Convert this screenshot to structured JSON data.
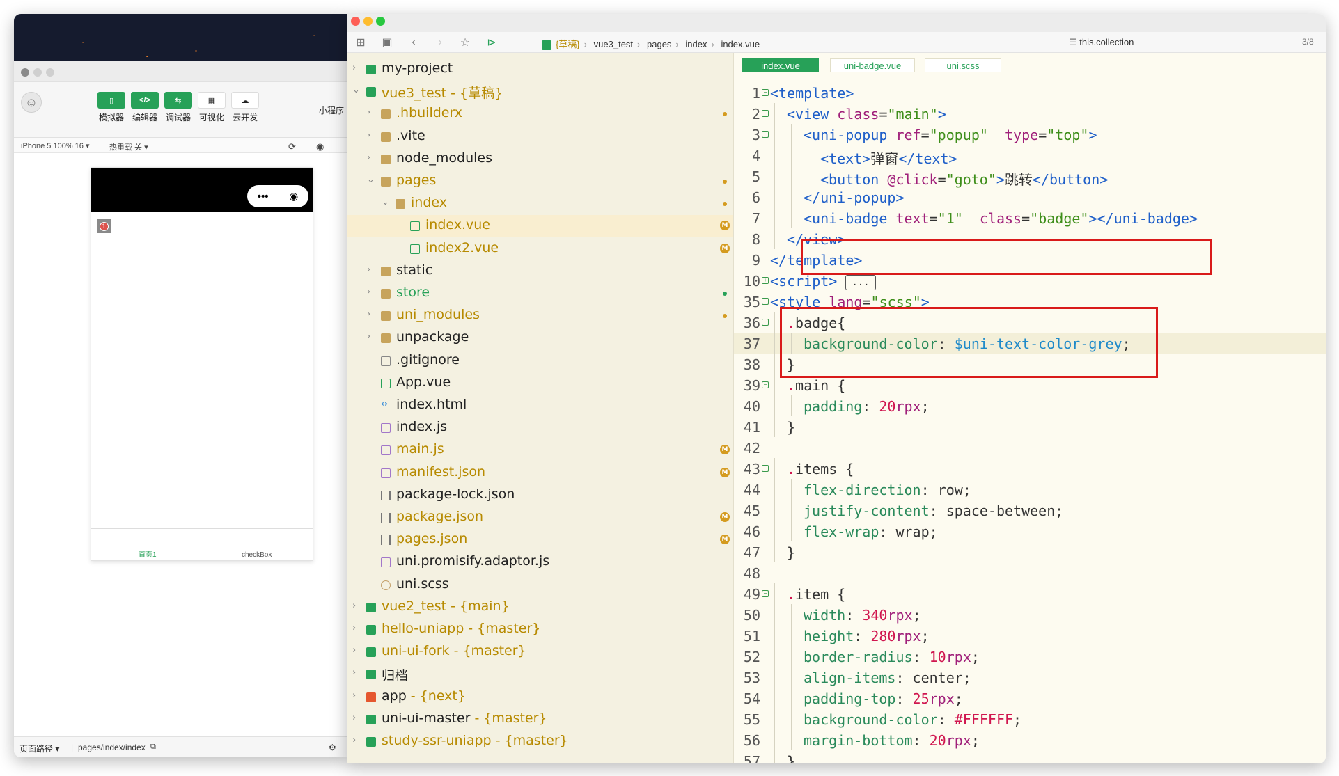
{
  "simulator": {
    "toolbar": [
      {
        "label": "模拟器",
        "icon": "phone-icon",
        "style": "green"
      },
      {
        "label": "编辑器",
        "icon": "code-icon",
        "style": "green"
      },
      {
        "label": "调试器",
        "icon": "debug-icon",
        "style": "green"
      },
      {
        "label": "可视化",
        "icon": "layout-icon",
        "style": "white"
      },
      {
        "label": "云开发",
        "icon": "cloud-icon",
        "style": "white"
      }
    ],
    "mini_program_label": "小程序",
    "device": "iPhone 5 100% 16 ▾",
    "hot_reload": "热重载 关 ▾",
    "capsule_more": "•••",
    "badge_text": "1",
    "tabbar": [
      {
        "label": "首页1",
        "color": "#27a158"
      },
      {
        "label": "checkBox",
        "color": "#555555"
      }
    ],
    "footer_path_label": "页面路径 ▾",
    "footer_path": "pages/index/index"
  },
  "editor": {
    "breadcrumb": [
      "{草稿}",
      "vue3_test",
      "pages",
      "index",
      "index.vue"
    ],
    "search_text": "this.collection",
    "search_count": "3/8",
    "tree": [
      {
        "name": "my-project",
        "sub": "",
        "icon": "project",
        "level": 0,
        "arrow": "›",
        "mark": ""
      },
      {
        "name": "vue3_test",
        "sub": " - {草稿}",
        "icon": "project",
        "level": 0,
        "arrow": "⌄",
        "mark": "",
        "color": "#b78a00"
      },
      {
        "name": ".hbuilderx",
        "sub": "",
        "icon": "folder",
        "level": 1,
        "arrow": "›",
        "mark": "dot",
        "color": "#b78a00"
      },
      {
        "name": ".vite",
        "sub": "",
        "icon": "folder",
        "level": 1,
        "arrow": "›",
        "mark": ""
      },
      {
        "name": "node_modules",
        "sub": "",
        "icon": "folder",
        "level": 1,
        "arrow": "›",
        "mark": ""
      },
      {
        "name": "pages",
        "sub": "",
        "icon": "folder",
        "level": 1,
        "arrow": "⌄",
        "mark": "dot",
        "color": "#b78a00"
      },
      {
        "name": "index",
        "sub": "",
        "icon": "folder",
        "level": 2,
        "arrow": "⌄",
        "mark": "dot",
        "color": "#b78a00"
      },
      {
        "name": "index.vue",
        "sub": "",
        "icon": "vue",
        "level": 3,
        "arrow": "",
        "mark": "M",
        "color": "#b78a00",
        "selected": true
      },
      {
        "name": "index2.vue",
        "sub": "",
        "icon": "vue",
        "level": 3,
        "arrow": "",
        "mark": "M",
        "color": "#b78a00"
      },
      {
        "name": "static",
        "sub": "",
        "icon": "folder",
        "level": 1,
        "arrow": "›",
        "mark": ""
      },
      {
        "name": "store",
        "sub": "",
        "icon": "folder",
        "level": 1,
        "arrow": "›",
        "mark": "dotg",
        "color": "#27a158"
      },
      {
        "name": "uni_modules",
        "sub": "",
        "icon": "folder",
        "level": 1,
        "arrow": "›",
        "mark": "dot",
        "color": "#b78a00"
      },
      {
        "name": "unpackage",
        "sub": "",
        "icon": "folder",
        "level": 1,
        "arrow": "›",
        "mark": ""
      },
      {
        "name": ".gitignore",
        "sub": "",
        "icon": "file",
        "level": 1,
        "arrow": "",
        "mark": ""
      },
      {
        "name": "App.vue",
        "sub": "",
        "icon": "vue",
        "level": 1,
        "arrow": "",
        "mark": ""
      },
      {
        "name": "index.html",
        "sub": "",
        "icon": "html",
        "level": 1,
        "arrow": "",
        "mark": ""
      },
      {
        "name": "index.js",
        "sub": "",
        "icon": "js",
        "level": 1,
        "arrow": "",
        "mark": ""
      },
      {
        "name": "main.js",
        "sub": "",
        "icon": "js",
        "level": 1,
        "arrow": "",
        "mark": "M",
        "color": "#b78a00"
      },
      {
        "name": "manifest.json",
        "sub": "",
        "icon": "js",
        "level": 1,
        "arrow": "",
        "mark": "M",
        "color": "#b78a00"
      },
      {
        "name": "package-lock.json",
        "sub": "",
        "icon": "json",
        "level": 1,
        "arrow": "",
        "mark": ""
      },
      {
        "name": "package.json",
        "sub": "",
        "icon": "json",
        "level": 1,
        "arrow": "",
        "mark": "M",
        "color": "#b78a00"
      },
      {
        "name": "pages.json",
        "sub": "",
        "icon": "json",
        "level": 1,
        "arrow": "",
        "mark": "M",
        "color": "#b78a00"
      },
      {
        "name": "uni.promisify.adaptor.js",
        "sub": "",
        "icon": "js",
        "level": 1,
        "arrow": "",
        "mark": ""
      },
      {
        "name": "uni.scss",
        "sub": "",
        "icon": "scss",
        "level": 1,
        "arrow": "",
        "mark": ""
      },
      {
        "name": "vue2_test",
        "sub": " - {main}",
        "icon": "project",
        "level": 0,
        "arrow": "›",
        "mark": "",
        "color": "#b78a00"
      },
      {
        "name": "hello-uniapp",
        "sub": " - {master}",
        "icon": "project",
        "level": 0,
        "arrow": "›",
        "mark": "",
        "color": "#b78a00"
      },
      {
        "name": "uni-ui-fork",
        "sub": " - {master}",
        "icon": "project",
        "level": 0,
        "arrow": "›",
        "mark": "",
        "color": "#b78a00"
      },
      {
        "name": "归档",
        "sub": "",
        "icon": "project",
        "level": 0,
        "arrow": "›",
        "mark": ""
      },
      {
        "name": "app",
        "sub": " - {next}",
        "icon": "app",
        "level": 0,
        "arrow": "›",
        "mark": ""
      },
      {
        "name": "uni-ui-master",
        "sub": " - {master}",
        "icon": "project",
        "level": 0,
        "arrow": "›",
        "mark": ""
      },
      {
        "name": "study-ssr-uniapp",
        "sub": " - {master}",
        "icon": "project",
        "level": 0,
        "arrow": "›",
        "mark": "",
        "color": "#b78a00"
      }
    ],
    "tabs": [
      {
        "label": "index.vue",
        "active": true
      },
      {
        "label": "uni-badge.vue",
        "active": false
      },
      {
        "label": "uni.scss",
        "active": false
      }
    ],
    "code": [
      {
        "no": "1",
        "fold": "⊟",
        "indent": 0,
        "tokens": [
          [
            "t",
            "<template>"
          ]
        ]
      },
      {
        "no": "2",
        "fold": "⊟",
        "indent": 1,
        "tokens": [
          [
            "t",
            "<view "
          ],
          [
            "a",
            "class"
          ],
          [
            "",
            "="
          ],
          [
            "s",
            "\"main\""
          ],
          [
            "t",
            ">"
          ]
        ]
      },
      {
        "no": "3",
        "fold": "⊟",
        "indent": 2,
        "tokens": [
          [
            "t",
            "<uni-popup "
          ],
          [
            "a",
            "ref"
          ],
          [
            "",
            "="
          ],
          [
            "s",
            "\"popup\""
          ],
          [
            "",
            "  "
          ],
          [
            "a",
            "type"
          ],
          [
            "",
            "="
          ],
          [
            "s",
            "\"top\""
          ],
          [
            "t",
            ">"
          ]
        ]
      },
      {
        "no": "4",
        "fold": "",
        "indent": 3,
        "tokens": [
          [
            "t",
            "<text>"
          ],
          [
            "",
            "弹窗"
          ],
          [
            "t",
            "</text>"
          ]
        ]
      },
      {
        "no": "5",
        "fold": "",
        "indent": 3,
        "tokens": [
          [
            "t",
            "<button "
          ],
          [
            "a",
            "@click"
          ],
          [
            "",
            "="
          ],
          [
            "s",
            "\"goto\""
          ],
          [
            "t",
            ">"
          ],
          [
            "",
            "跳转"
          ],
          [
            "t",
            "</button>"
          ]
        ]
      },
      {
        "no": "6",
        "fold": "",
        "indent": 2,
        "tokens": [
          [
            "t",
            "</uni-popup>"
          ]
        ]
      },
      {
        "no": "7",
        "fold": "",
        "indent": 2,
        "tokens": [
          [
            "t",
            "<uni-badge "
          ],
          [
            "a",
            "text"
          ],
          [
            "",
            "="
          ],
          [
            "s",
            "\"1\""
          ],
          [
            "",
            "  "
          ],
          [
            "a",
            "class"
          ],
          [
            "",
            "="
          ],
          [
            "s",
            "\"badge\""
          ],
          [
            "t",
            "></uni-badge>"
          ]
        ]
      },
      {
        "no": "8",
        "fold": "",
        "indent": 1,
        "tokens": [
          [
            "t",
            "</view>"
          ]
        ]
      },
      {
        "no": "9",
        "fold": "",
        "indent": 0,
        "tokens": [
          [
            "t",
            "</template>"
          ]
        ]
      },
      {
        "no": "10",
        "fold": "⊞",
        "indent": 0,
        "tokens": [
          [
            "t",
            "<script>"
          ]
        ],
        "ellipsis": "..."
      },
      {
        "no": "35",
        "fold": "⊟",
        "indent": 0,
        "tokens": [
          [
            "t",
            "<style "
          ],
          [
            "a",
            "lang"
          ],
          [
            "",
            "="
          ],
          [
            "s",
            "\"scss\""
          ],
          [
            "t",
            ">"
          ]
        ]
      },
      {
        "no": "36",
        "fold": "⊟",
        "indent": 1,
        "tokens": [
          [
            "n",
            "."
          ],
          [
            "",
            "badge{"
          ]
        ]
      },
      {
        "no": "37",
        "fold": "",
        "indent": 2,
        "tokens": [
          [
            "p",
            "background-color"
          ],
          [
            "",
            ": "
          ],
          [
            "v",
            "$uni-text-color-grey"
          ],
          [
            "",
            ";"
          ]
        ],
        "current": true
      },
      {
        "no": "38",
        "fold": "",
        "indent": 1,
        "tokens": [
          [
            "",
            "}"
          ]
        ]
      },
      {
        "no": "39",
        "fold": "⊟",
        "indent": 1,
        "tokens": [
          [
            "n",
            "."
          ],
          [
            "",
            "main {"
          ]
        ]
      },
      {
        "no": "40",
        "fold": "",
        "indent": 2,
        "tokens": [
          [
            "p",
            "padding"
          ],
          [
            "",
            ": "
          ],
          [
            "n",
            "20"
          ],
          [
            "k",
            "rpx"
          ],
          [
            "",
            ";"
          ]
        ]
      },
      {
        "no": "41",
        "fold": "",
        "indent": 1,
        "tokens": [
          [
            "",
            "}"
          ]
        ]
      },
      {
        "no": "42",
        "fold": "",
        "indent": 0,
        "tokens": []
      },
      {
        "no": "43",
        "fold": "⊟",
        "indent": 1,
        "tokens": [
          [
            "n",
            "."
          ],
          [
            "",
            "items {"
          ]
        ]
      },
      {
        "no": "44",
        "fold": "",
        "indent": 2,
        "tokens": [
          [
            "p",
            "flex-direction"
          ],
          [
            "",
            ": row;"
          ]
        ]
      },
      {
        "no": "45",
        "fold": "",
        "indent": 2,
        "tokens": [
          [
            "p",
            "justify-content"
          ],
          [
            "",
            ": space-between;"
          ]
        ]
      },
      {
        "no": "46",
        "fold": "",
        "indent": 2,
        "tokens": [
          [
            "p",
            "flex-wrap"
          ],
          [
            "",
            ": wrap;"
          ]
        ]
      },
      {
        "no": "47",
        "fold": "",
        "indent": 1,
        "tokens": [
          [
            "",
            "}"
          ]
        ]
      },
      {
        "no": "48",
        "fold": "",
        "indent": 0,
        "tokens": []
      },
      {
        "no": "49",
        "fold": "⊟",
        "indent": 1,
        "tokens": [
          [
            "n",
            "."
          ],
          [
            "",
            "item {"
          ]
        ]
      },
      {
        "no": "50",
        "fold": "",
        "indent": 2,
        "tokens": [
          [
            "p",
            "width"
          ],
          [
            "",
            ": "
          ],
          [
            "n",
            "340"
          ],
          [
            "k",
            "rpx"
          ],
          [
            "",
            ";"
          ]
        ]
      },
      {
        "no": "51",
        "fold": "",
        "indent": 2,
        "tokens": [
          [
            "p",
            "height"
          ],
          [
            "",
            ": "
          ],
          [
            "n",
            "280"
          ],
          [
            "k",
            "rpx"
          ],
          [
            "",
            ";"
          ]
        ]
      },
      {
        "no": "52",
        "fold": "",
        "indent": 2,
        "tokens": [
          [
            "p",
            "border-radius"
          ],
          [
            "",
            ": "
          ],
          [
            "n",
            "10"
          ],
          [
            "k",
            "rpx"
          ],
          [
            "",
            ";"
          ]
        ]
      },
      {
        "no": "53",
        "fold": "",
        "indent": 2,
        "tokens": [
          [
            "p",
            "align-items"
          ],
          [
            "",
            ": center;"
          ]
        ]
      },
      {
        "no": "54",
        "fold": "",
        "indent": 2,
        "tokens": [
          [
            "p",
            "padding-top"
          ],
          [
            "",
            ": "
          ],
          [
            "n",
            "25"
          ],
          [
            "k",
            "rpx"
          ],
          [
            "",
            ";"
          ]
        ]
      },
      {
        "no": "55",
        "fold": "",
        "indent": 2,
        "tokens": [
          [
            "p",
            "background-color"
          ],
          [
            "",
            ": "
          ],
          [
            "n",
            "#FFFFFF"
          ],
          [
            "",
            ";"
          ]
        ]
      },
      {
        "no": "56",
        "fold": "",
        "indent": 2,
        "tokens": [
          [
            "p",
            "margin-bottom"
          ],
          [
            "",
            ": "
          ],
          [
            "n",
            "20"
          ],
          [
            "k",
            "rpx"
          ],
          [
            "",
            ";"
          ]
        ]
      },
      {
        "no": "57",
        "fold": "",
        "indent": 1,
        "tokens": [
          [
            "",
            "}"
          ]
        ]
      }
    ]
  },
  "colors": {
    "accent": "#27a158",
    "highlight_box": "#d91a1a",
    "tree_bg": "#f4f1e1",
    "modified": "#b78a00"
  }
}
